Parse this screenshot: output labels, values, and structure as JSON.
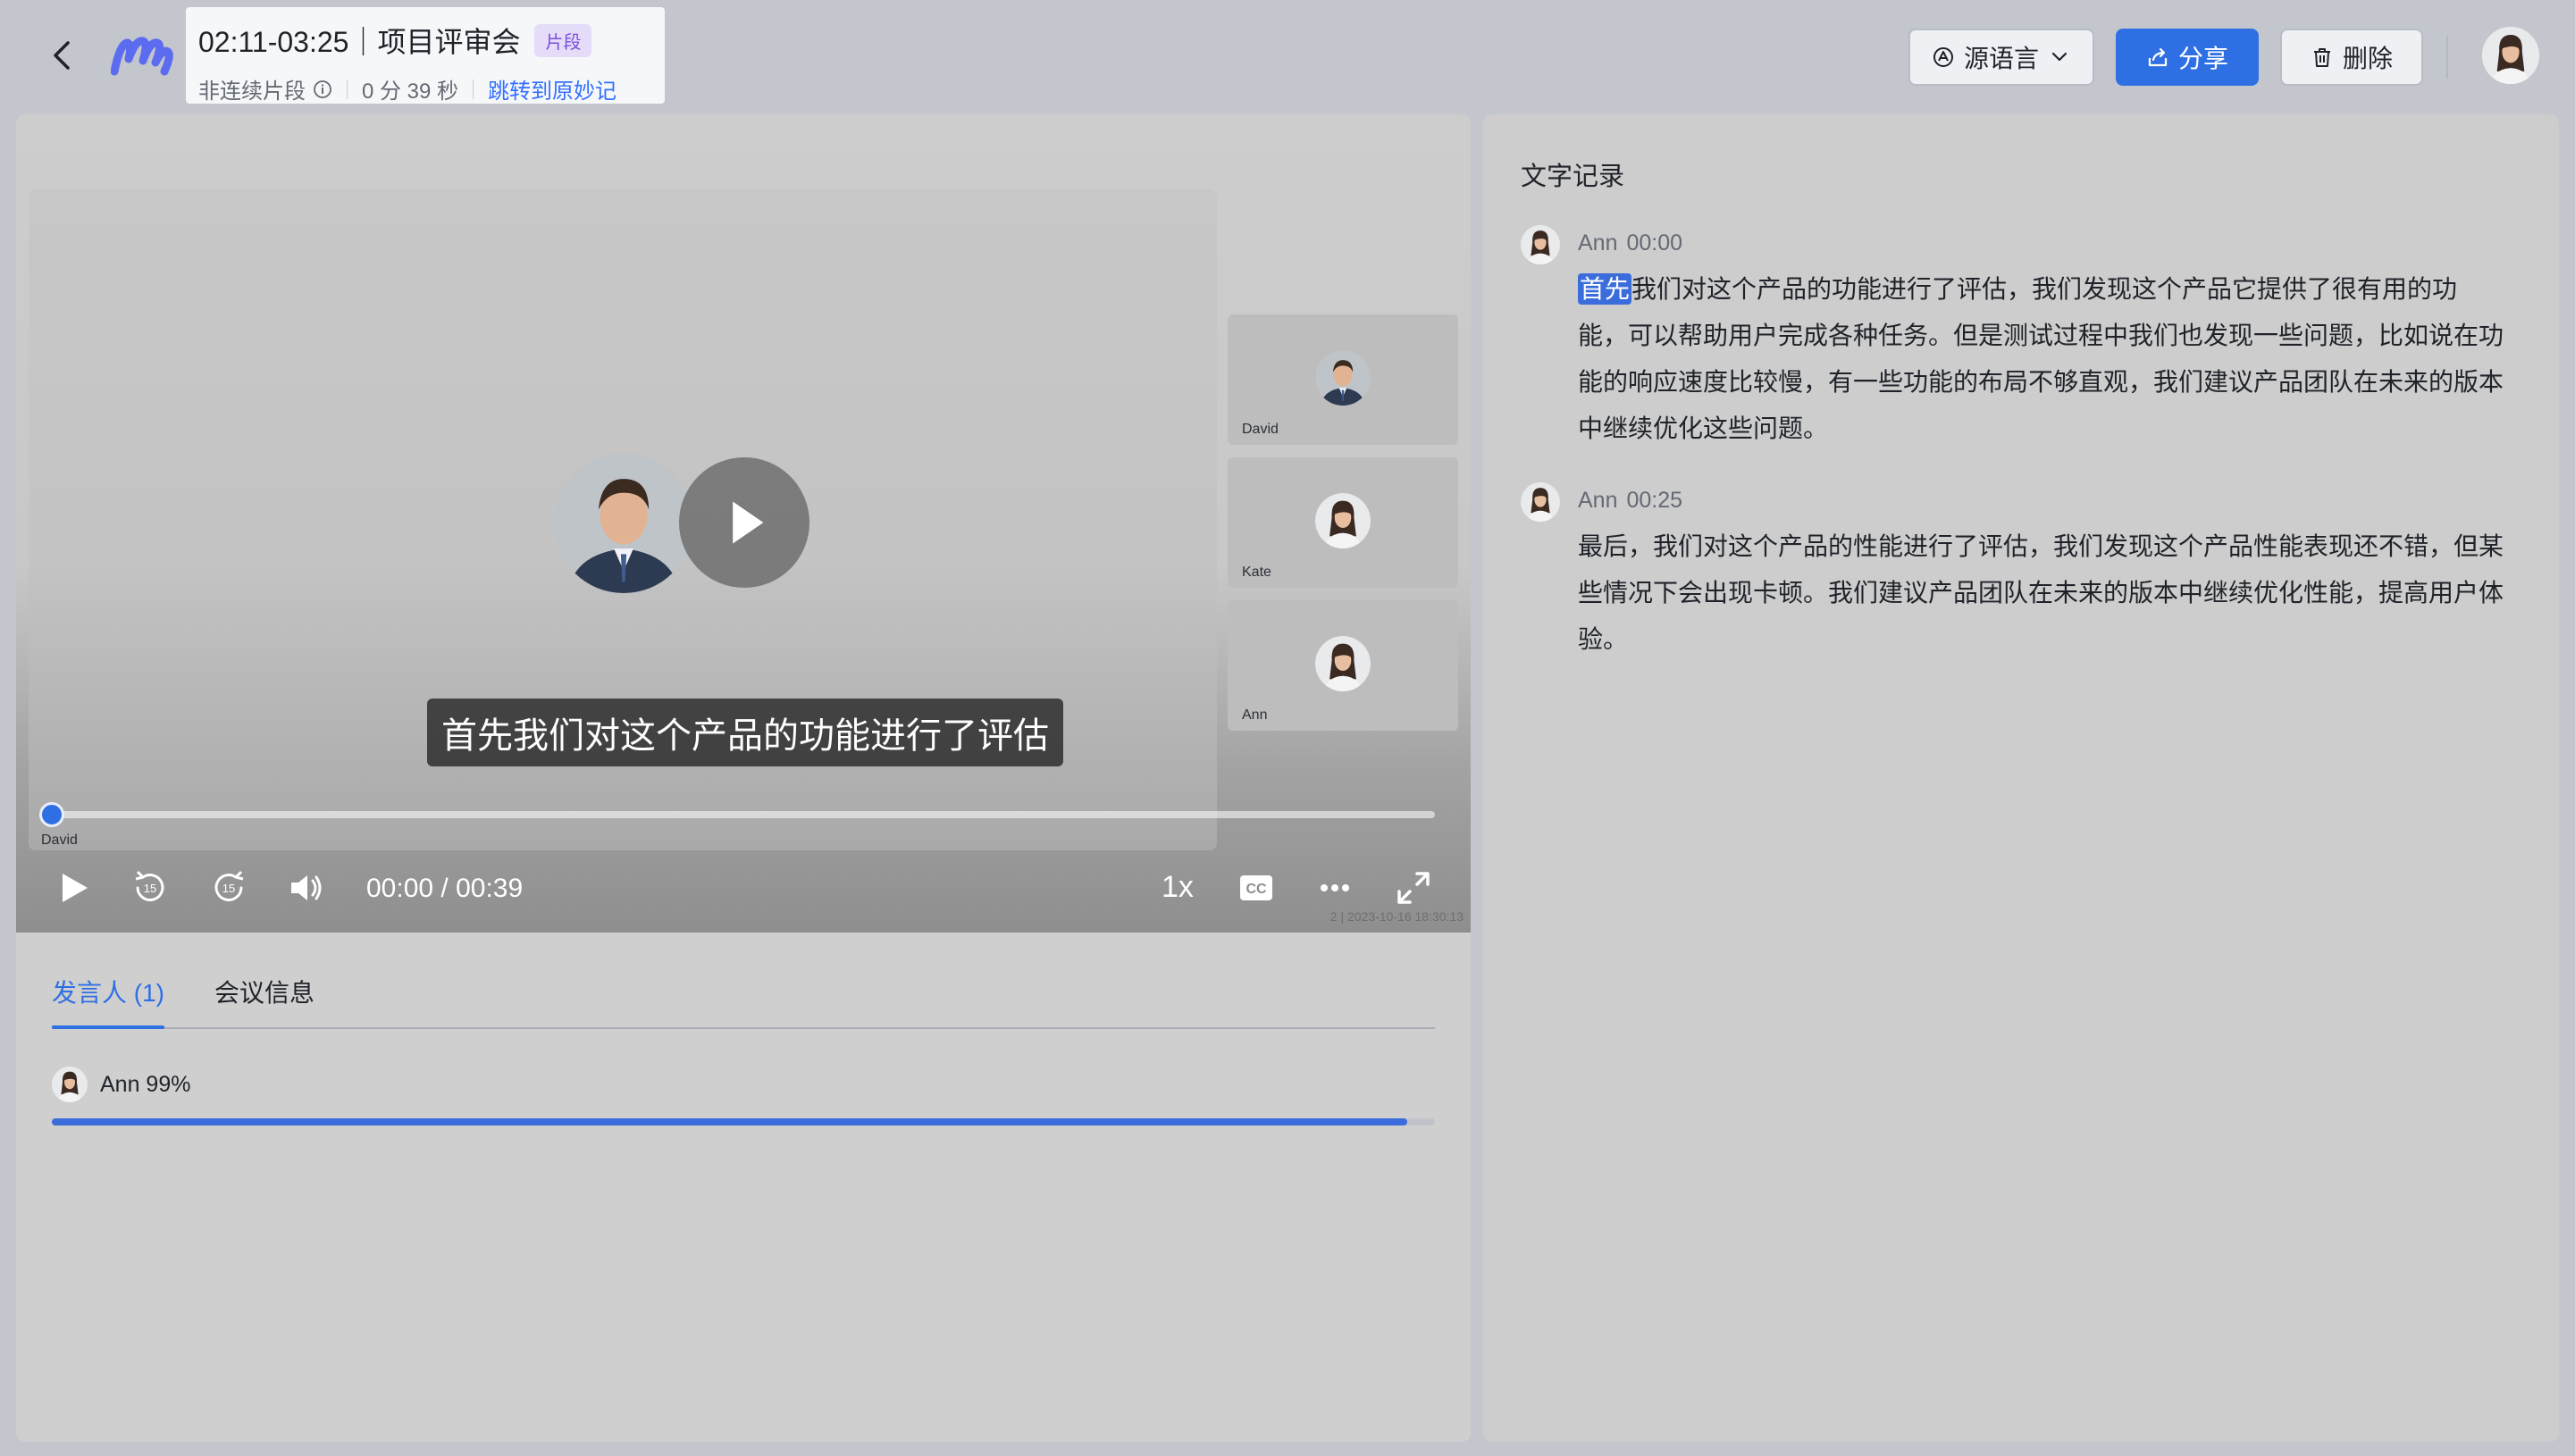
{
  "header": {
    "title": "02:11-03:25｜项目评审会",
    "badge": "片段",
    "meta_type": "非连续片段",
    "meta_duration": "0 分 39 秒",
    "jump_link": "跳转到原妙记",
    "lang_button": "源语言",
    "share_button": "分享",
    "delete_button": "删除"
  },
  "player": {
    "subtitle": "首先我们对这个产品的功能进行了评估",
    "current_time": "00:00",
    "total_time": "00:39",
    "time_display": "00:00 / 00:39",
    "speed": "1x",
    "progress_fraction": 0.0,
    "progress_label": "David",
    "watermark": "2  |  2023-10-16 18:30:13",
    "participants": [
      {
        "name": "David"
      },
      {
        "name": "Kate"
      },
      {
        "name": "Ann"
      }
    ]
  },
  "tabs": {
    "speakers": "发言人 (1)",
    "meeting_info": "会议信息"
  },
  "speakers": [
    {
      "label": "Ann 99%",
      "fraction": 0.98
    }
  ],
  "transcript": {
    "title": "文字记录",
    "entries": [
      {
        "speaker": "Ann",
        "time": "00:00",
        "highlight": "首先",
        "text": "我们对这个产品的功能进行了评估，我们发现这个产品它提供了很有用的功能，可以帮助用户完成各种任务。但是测试过程中我们也发现一些问题，比如说在功能的响应速度比较慢，有一些功能的布局不够直观，我们建议产品团队在未来的版本中继续优化这些问题。"
      },
      {
        "speaker": "Ann",
        "time": "00:25",
        "text": "最后，我们对这个产品的性能进行了评估，我们发现这个产品性能表现还不错，但某些情况下会出现卡顿。我们建议产品团队在未来的版本中继续优化性能，提高用户体验。"
      }
    ]
  },
  "colors": {
    "accent": "#2f6fe4",
    "badge_bg": "#e5dcfa",
    "badge_text": "#7a4fd8",
    "link": "#3370ff"
  },
  "icons": {
    "back": "chevron-left-icon",
    "logo": "minutes-logo-icon",
    "info": "info-icon",
    "language": "language-icon",
    "share": "share-icon",
    "delete": "trash-icon",
    "play": "play-icon",
    "rewind": "rewind-15-icon",
    "forward": "forward-15-icon",
    "volume": "volume-icon",
    "captions": "cc-icon",
    "more": "more-icon",
    "fullscreen": "fullscreen-icon"
  }
}
